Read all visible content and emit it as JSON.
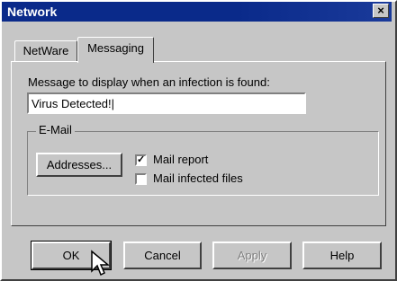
{
  "window": {
    "title": "Network"
  },
  "tabs": [
    {
      "label": "NetWare"
    },
    {
      "label": "Messaging"
    }
  ],
  "messaging": {
    "prompt_label": "Message to display when an infection is found:",
    "message_value": "Virus Detected!",
    "email_group_label": "E-Mail",
    "addresses_button": "Addresses...",
    "mail_report_label": "Mail report",
    "mail_report_checked": true,
    "mail_infected_label": "Mail infected files",
    "mail_infected_checked": false
  },
  "buttons": {
    "ok": "OK",
    "cancel": "Cancel",
    "apply": "Apply",
    "help": "Help"
  },
  "colors": {
    "titlebar": "#0a2a8a",
    "face": "#c6c6c6"
  }
}
